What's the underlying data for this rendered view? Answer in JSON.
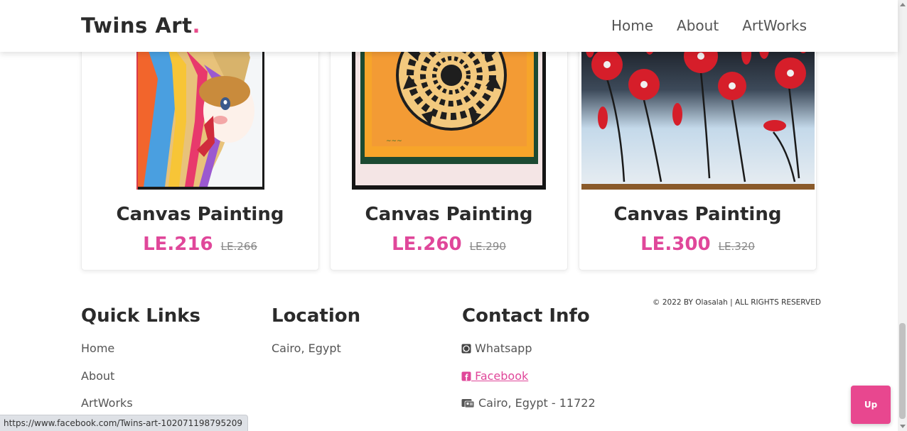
{
  "brand": {
    "name": "Twins Art",
    "dot": ".",
    "accent": "#e84c8b"
  },
  "nav": {
    "items": [
      "Home",
      "About",
      "ArtWorks"
    ]
  },
  "cards": [
    {
      "title": "Canvas Painting",
      "price": "LE.216",
      "old_price": "LE.266",
      "art": "feather-headdress-girl-painting"
    },
    {
      "title": "Canvas Painting",
      "price": "LE.260",
      "old_price": "LE.290",
      "art": "geometric-mandala-painting"
    },
    {
      "title": "Canvas Painting",
      "price": "LE.300",
      "old_price": "LE.320",
      "art": "red-poppies-painting"
    }
  ],
  "footer": {
    "quick_links": {
      "heading": "Quick Links",
      "items": [
        "Home",
        "About",
        "ArtWorks"
      ]
    },
    "location": {
      "heading": "Location",
      "text": "Cairo, Egypt"
    },
    "contact": {
      "heading": "Contact Info",
      "whatsapp": "Whatsapp",
      "facebook": " Facebook",
      "address": "Cairo, Egypt - 11722"
    },
    "copyright": "© 2022 BY Olasalah | ALL RIGHTS RESERVED"
  },
  "up_button": "Up",
  "status_bar": {
    "url": "https://www.facebook.com/Twins-art-102071198795209"
  },
  "colors": {
    "price": "#e0479a",
    "up_button": "#e8478f"
  }
}
